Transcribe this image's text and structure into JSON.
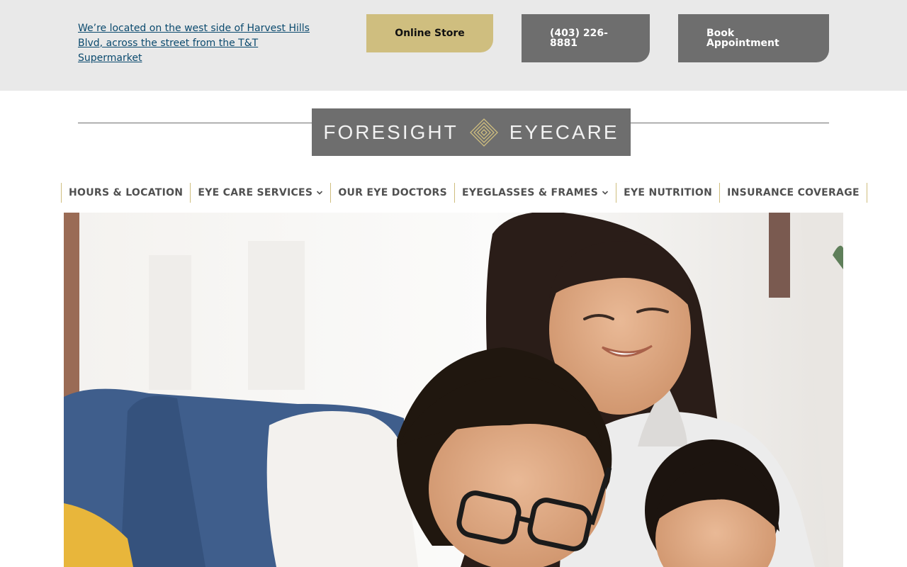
{
  "header": {
    "location_text": "We’re located on the west side of Harvest Hills Blvd, across the street from the T&T Supermarket",
    "online_store_label": "Online Store",
    "phone_label": "(403) 226-8881",
    "book_label": "Book Appointment"
  },
  "brand": {
    "word_left": "FORESIGHT",
    "word_right": "EYECARE"
  },
  "nav": {
    "items": [
      {
        "label": "HOURS & LOCATION",
        "has_dropdown": false
      },
      {
        "label": "EYE CARE SERVICES",
        "has_dropdown": true
      },
      {
        "label": "OUR EYE DOCTORS",
        "has_dropdown": false
      },
      {
        "label": "EYEGLASSES & FRAMES",
        "has_dropdown": true
      },
      {
        "label": "EYE NUTRITION",
        "has_dropdown": false
      },
      {
        "label": "INSURANCE COVERAGE",
        "has_dropdown": false
      }
    ]
  },
  "colors": {
    "topbar_bg": "#e9e9e9",
    "gold": "#cfbe7f",
    "gray": "#6e6e6e",
    "link": "#0b4a6e"
  },
  "icons": {
    "logo_mark": "diamond-logo-icon",
    "dropdown": "chevron-down-icon"
  }
}
